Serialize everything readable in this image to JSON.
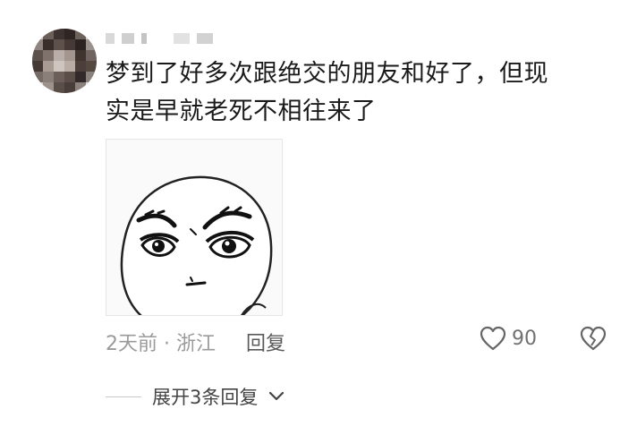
{
  "comment": {
    "text_line1": "梦到了好多次跟绝交的朋友和好了，但现",
    "text_line2": "实是早就老死不相往来了"
  },
  "meta": {
    "time_location": "2天前 · 浙江",
    "reply_label": "回复"
  },
  "actions": {
    "like_count": "90"
  },
  "expand_replies_label": "展开3条回复",
  "icons": {
    "avatar": "avatar",
    "sticker": "grumpy-face-sticker",
    "like": "heart-outline-icon",
    "dislike": "broken-heart-icon",
    "expand": "chevron-down-icon"
  }
}
